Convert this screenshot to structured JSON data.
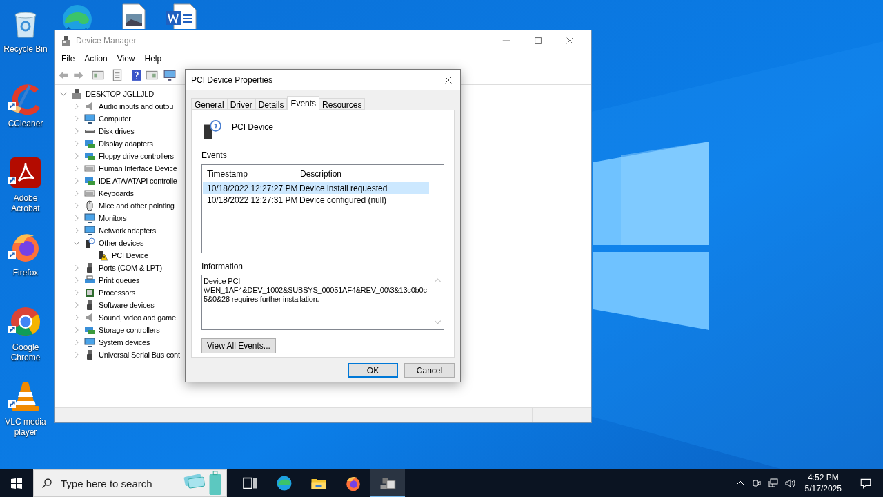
{
  "desktop_icons": [
    {
      "kind": "recycle",
      "label": "Recycle Bin"
    },
    {
      "kind": "ccleaner",
      "label": "CCleaner"
    },
    {
      "kind": "acrobat",
      "label": "Adobe Acrobat"
    },
    {
      "kind": "firefox",
      "label": "Firefox"
    },
    {
      "kind": "chrome",
      "label": "Google Chrome"
    },
    {
      "kind": "vlc",
      "label": "VLC media player"
    }
  ],
  "top_icons": [
    {
      "kind": "edge"
    },
    {
      "kind": "image"
    },
    {
      "kind": "word"
    }
  ],
  "device_manager": {
    "title": "Device Manager",
    "menu": [
      "File",
      "Action",
      "View",
      "Help"
    ],
    "tree": {
      "label": "DESKTOP-JGLLJLD",
      "kind": "computer",
      "expanded": true,
      "children": [
        {
          "label": "Audio inputs and outpu",
          "kind": "speaker",
          "expanded": false
        },
        {
          "label": "Computer",
          "kind": "monitor",
          "expanded": false
        },
        {
          "label": "Disk drives",
          "kind": "disk",
          "expanded": false
        },
        {
          "label": "Display adapters",
          "kind": "card",
          "expanded": false
        },
        {
          "label": "Floppy drive controllers",
          "kind": "card",
          "expanded": false
        },
        {
          "label": "Human Interface Device",
          "kind": "keyboard",
          "expanded": false
        },
        {
          "label": "IDE ATA/ATAPI controlle",
          "kind": "card",
          "expanded": false
        },
        {
          "label": "Keyboards",
          "kind": "keyboard",
          "expanded": false
        },
        {
          "label": "Mice and other pointing",
          "kind": "mouse",
          "expanded": false
        },
        {
          "label": "Monitors",
          "kind": "monitor",
          "expanded": false
        },
        {
          "label": "Network adapters",
          "kind": "monitor",
          "expanded": false
        },
        {
          "label": "Other devices",
          "kind": "unknown",
          "expanded": true,
          "children": [
            {
              "label": "PCI Device",
              "kind": "warning"
            }
          ]
        },
        {
          "label": "Ports (COM & LPT)",
          "kind": "port",
          "expanded": false
        },
        {
          "label": "Print queues",
          "kind": "printer",
          "expanded": false
        },
        {
          "label": "Processors",
          "kind": "chip",
          "expanded": false
        },
        {
          "label": "Software devices",
          "kind": "port",
          "expanded": false
        },
        {
          "label": "Sound, video and game",
          "kind": "speaker",
          "expanded": false
        },
        {
          "label": "Storage controllers",
          "kind": "card",
          "expanded": false
        },
        {
          "label": "System devices",
          "kind": "monitor",
          "expanded": false
        },
        {
          "label": "Universal Serial Bus cont",
          "kind": "port",
          "expanded": false
        }
      ]
    }
  },
  "dialog": {
    "title": "PCI Device Properties",
    "tabs": [
      {
        "label": "General",
        "selected": false
      },
      {
        "label": "Driver",
        "selected": false
      },
      {
        "label": "Details",
        "selected": false
      },
      {
        "label": "Events",
        "selected": true
      },
      {
        "label": "Resources",
        "selected": false
      }
    ],
    "device_name": "PCI Device",
    "events_label": "Events",
    "columns": [
      "Timestamp",
      "Description"
    ],
    "rows": [
      {
        "timestamp": "10/18/2022 12:27:27 PM",
        "description": "Device install requested",
        "selected": true
      },
      {
        "timestamp": "10/18/2022 12:27:31 PM",
        "description": "Device configured (null)",
        "selected": false
      }
    ],
    "information_label": "Information",
    "information": "Device PCI \\VEN_1AF4&DEV_1002&SUBSYS_00051AF4&REV_00\\3&13c0b0c5&0&28 requires further installation.",
    "view_all_button": "View All Events...",
    "buttons": [
      {
        "label": "OK",
        "default": true
      },
      {
        "label": "Cancel",
        "default": false
      }
    ]
  },
  "taskbar": {
    "search_placeholder": "Type here to search",
    "apps": [
      {
        "kind": "taskview",
        "active": false
      },
      {
        "kind": "edge",
        "active": false
      },
      {
        "kind": "explorer",
        "active": false
      },
      {
        "kind": "firefox",
        "active": false
      },
      {
        "kind": "devmgr",
        "active": true
      }
    ],
    "time": "4:52 PM",
    "date": "5/17/2025"
  }
}
